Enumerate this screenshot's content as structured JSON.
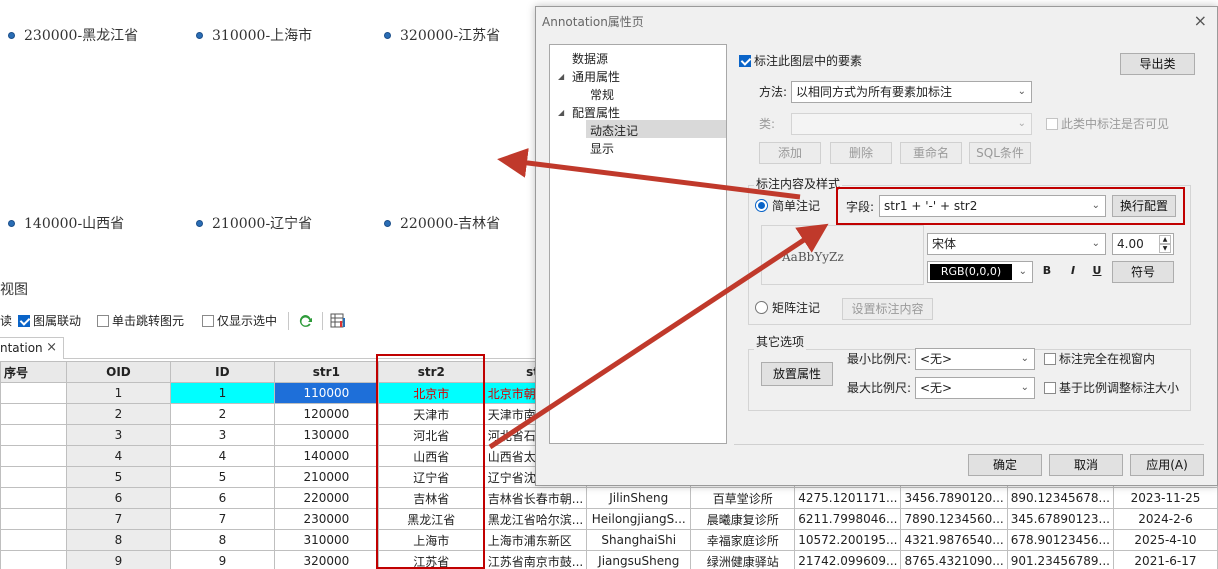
{
  "map_labels": [
    {
      "text": "230000-黑龙江省"
    },
    {
      "text": "310000-上海市"
    },
    {
      "text": "320000-江苏省"
    },
    {
      "text": "140000-山西省"
    },
    {
      "text": "210000-辽宁省"
    },
    {
      "text": "220000-吉林省"
    }
  ],
  "view": {
    "title": "视图",
    "toolbar": {
      "readonly_partial": "读",
      "layer_link": "图属联动",
      "single_click_jump": "单击跳转图元",
      "show_selected_only": "仅显示选中"
    },
    "tab_label": "ntation",
    "tab_close": "×"
  },
  "grid": {
    "headers": [
      "序号",
      "OID",
      "ID",
      "str1",
      "str2",
      "str",
      "",
      "",
      "",
      "",
      "",
      ""
    ],
    "rows": [
      [
        "",
        "1",
        "1",
        "110000",
        "北京市",
        "北京市朝",
        "",
        "",
        "",
        "",
        "",
        ""
      ],
      [
        "",
        "2",
        "2",
        "120000",
        "天津市",
        "天津市南",
        "",
        "",
        "",
        "",
        "",
        ""
      ],
      [
        "",
        "3",
        "3",
        "130000",
        "河北省",
        "河北省石",
        "",
        "",
        "",
        "",
        "",
        ""
      ],
      [
        "",
        "4",
        "4",
        "140000",
        "山西省",
        "山西省太",
        "",
        "",
        "",
        "",
        "",
        ""
      ],
      [
        "",
        "5",
        "5",
        "210000",
        "辽宁省",
        "辽宁省沈",
        "",
        "",
        "",
        "",
        "",
        ""
      ],
      [
        "",
        "6",
        "6",
        "220000",
        "吉林省",
        "吉林省长春市朝...",
        "JilinSheng",
        "百草堂诊所",
        "4275.1201171...",
        "3456.7890120...",
        "890.12345678...",
        "2023-11-25"
      ],
      [
        "",
        "7",
        "7",
        "230000",
        "黑龙江省",
        "黑龙江省哈尔滨...",
        "HeilongjiangS...",
        "晨曦康复诊所",
        "6211.7998046...",
        "7890.1234560...",
        "345.67890123...",
        "2024-2-6"
      ],
      [
        "",
        "8",
        "8",
        "310000",
        "上海市",
        "上海市浦东新区",
        "ShanghaiShi",
        "幸福家庭诊所",
        "10572.200195...",
        "4321.9876540...",
        "678.90123456...",
        "2025-4-10"
      ],
      [
        "",
        "9",
        "9",
        "320000",
        "江苏省",
        "江苏省南京市鼓...",
        "JiangsuSheng",
        "绿洲健康驿站",
        "21742.099609...",
        "8765.4321090...",
        "901.23456789...",
        "2021-6-17"
      ]
    ]
  },
  "dialog": {
    "title": "Annotation属性页",
    "close": "×",
    "tree": {
      "items": [
        "数据源",
        "通用属性",
        "常规",
        "配置属性",
        "动态注记",
        "显示"
      ],
      "expander": "◢"
    },
    "label_features": "标注此图层中的要素",
    "export_classes": "导出类",
    "method_label": "方法:",
    "method_value": "以相同方式为所有要素加标注",
    "class_label": "类:",
    "class_value": "",
    "class_visible": "此类中标注是否可见",
    "buttons": {
      "add": "添加",
      "delete": "删除",
      "rename": "重命名",
      "sql": "SQL条件"
    },
    "content_group": "标注内容及样式",
    "simple_label": "简单注记",
    "field_label": "字段:",
    "field_value": "str1 + '-' + str2",
    "wrap_config": "换行配置",
    "preview_text": "AaBbYyZz",
    "font_value": "宋体",
    "font_size": "4.00",
    "color_value": "RGB(0,0,0)",
    "bold": "B",
    "italic": "I",
    "underline": "U",
    "symbol": "符号",
    "matrix_label": "矩阵注记",
    "set_content": "设置标注内容",
    "other_group": "其它选项",
    "placement": "放置属性",
    "min_scale_label": "最小比例尺:",
    "min_scale_value": "<无>",
    "max_scale_label": "最大比例尺:",
    "max_scale_value": "<无>",
    "fully_in_view": "标注完全在视窗内",
    "scale_by_ratio": "基于比例调整标注大小",
    "ok": "确定",
    "cancel": "取消",
    "apply": "应用(A)"
  },
  "colors": {
    "accent": "#0a64c8",
    "arrow": "#c0392b",
    "highlight_box": "#c00000",
    "selected_row": "#00ffff",
    "selected_cell": "#1e6fd9"
  }
}
